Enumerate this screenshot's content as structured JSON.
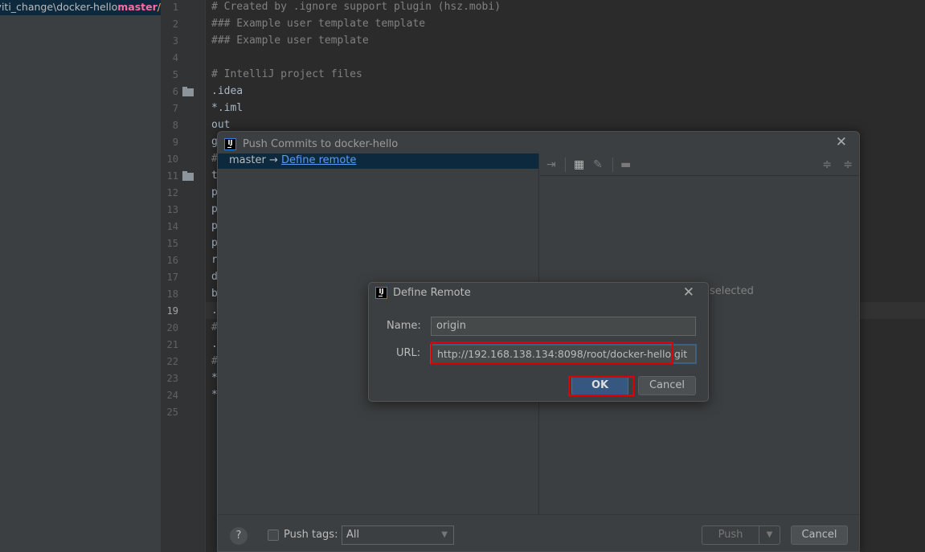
{
  "project_panel": {
    "path": "tiviti_change\\docker-hello",
    "branch": "master",
    "sep": "/"
  },
  "editor": {
    "line_numbers": [
      "1",
      "2",
      "3",
      "4",
      "5",
      "6",
      "7",
      "8",
      "9",
      "10",
      "11",
      "12",
      "13",
      "14",
      "15",
      "16",
      "17",
      "18",
      "19",
      "20",
      "21",
      "22",
      "23",
      "24",
      "25"
    ],
    "current_line": "19",
    "lines": [
      "# Created by .ignore support plugin (hsz.mobi)",
      "### Example user template template",
      "### Example user template",
      "",
      "# IntelliJ project files",
      ".idea",
      "*.iml",
      "out",
      "g",
      "#",
      "t",
      "p",
      "p",
      "p",
      "p",
      "r",
      "d",
      "b",
      ".",
      "#",
      ".",
      "#",
      "*",
      "*",
      ""
    ]
  },
  "push_dialog": {
    "title": "Push Commits to docker-hello",
    "branch": "master",
    "arrow": "→",
    "define_remote_link": "Define remote",
    "no_selection_text": "selected",
    "push_tags_label": "Push tags:",
    "push_tags_value": "All",
    "help": "?",
    "push_label": "Push",
    "cancel_label": "Cancel"
  },
  "define_remote": {
    "title": "Define Remote",
    "name_label": "Name:",
    "name_value": "origin",
    "url_label": "URL:",
    "url_value": "http://192.168.138.134:8098/root/docker-hello.git",
    "ok_label": "OK",
    "cancel_label": "Cancel"
  },
  "icons": {
    "logo": "IJ",
    "close": "✕"
  }
}
